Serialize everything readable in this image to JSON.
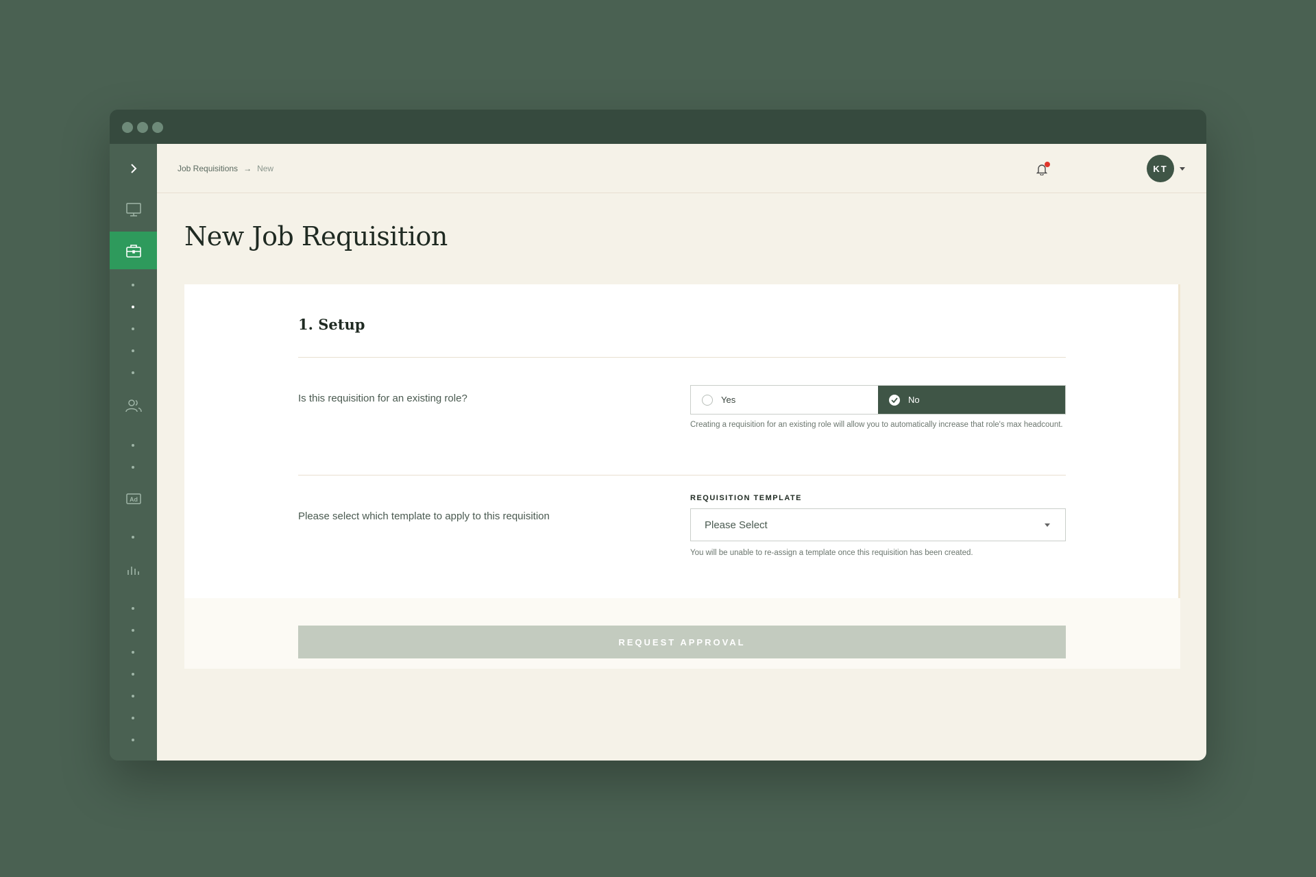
{
  "window": {
    "traffic_lights": [
      "close",
      "minimize",
      "maximize"
    ]
  },
  "sidebar": {
    "expand_icon": "chevron-right-icon",
    "items": [
      {
        "icon": "monitor-icon",
        "active": false
      },
      {
        "icon": "briefcase-icon",
        "active": true
      },
      {
        "icon": "people-icon",
        "active": false
      },
      {
        "icon": "ad-icon",
        "active": false
      },
      {
        "icon": "bar-chart-icon",
        "active": false
      }
    ],
    "accent_color": "#2e9a5c"
  },
  "header": {
    "breadcrumb": {
      "parent": "Job Requisitions",
      "separator": "→",
      "current": "New"
    },
    "notification_icon": "bell-icon",
    "notification_badge_color": "#e0362b",
    "avatar_initials": "KT"
  },
  "page": {
    "title": "New Job Requisition"
  },
  "form": {
    "section_title": "1. Setup",
    "existing_role": {
      "question": "Is this requisition for an existing role?",
      "options": [
        "Yes",
        "No"
      ],
      "selected": "No",
      "help": "Creating a requisition for an existing role will allow you to automatically increase that role's max headcount."
    },
    "template": {
      "question": "Please select which template to apply to this requisition",
      "label": "REQUISITION TEMPLATE",
      "value": "Please Select",
      "help": "You will be unable to re-assign a template once this requisition has been created."
    },
    "submit_label": "REQUEST APPROVAL"
  }
}
